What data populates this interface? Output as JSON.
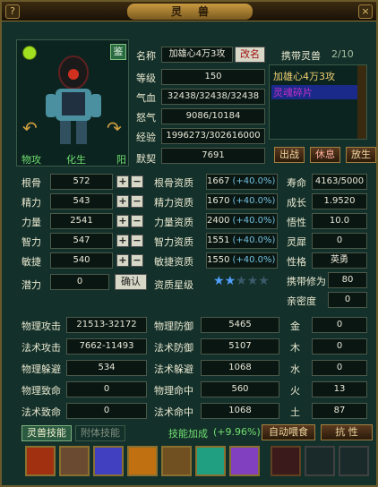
{
  "window": {
    "title": "灵兽",
    "help_icon": "?",
    "close_icon": "×"
  },
  "pet": {
    "left_tag": "物攻",
    "mid_tag": "化生",
    "right_tag": "阳",
    "appraise": "鉴",
    "name_label": "名称",
    "name": "加雄心4万3攻",
    "rename": "改名",
    "level_label": "等级",
    "level": "150",
    "hp_label": "气血",
    "hp": "32438/32438/32438",
    "rage_label": "怒气",
    "rage": "9086/10184",
    "exp_label": "经验",
    "exp": "1996273/302616000",
    "tacit_label": "默契",
    "tacit": "7691"
  },
  "carry": {
    "label": "携带灵兽",
    "count": "2/10",
    "items": [
      "加雄心4万3攻",
      "灵魂碎片"
    ],
    "fight": "出战",
    "rest": "休息",
    "release": "放生"
  },
  "attrs": [
    {
      "label": "根骨",
      "value": "572",
      "apt_label": "根骨资质",
      "apt": "1667",
      "pct": "(+40.0%)"
    },
    {
      "label": "精力",
      "value": "543",
      "apt_label": "精力资质",
      "apt": "1670",
      "pct": "(+40.0%)"
    },
    {
      "label": "力量",
      "value": "2541",
      "apt_label": "力量资质",
      "apt": "2400",
      "pct": "(+40.0%)"
    },
    {
      "label": "智力",
      "value": "547",
      "apt_label": "智力资质",
      "apt": "1551",
      "pct": "(+40.0%)"
    },
    {
      "label": "敏捷",
      "value": "540",
      "apt_label": "敏捷资质",
      "apt": "1550",
      "pct": "(+40.0%)"
    }
  ],
  "potential": {
    "label": "潜力",
    "value": "0",
    "confirm": "确认",
    "star_label": "资质星级"
  },
  "right_stats": [
    {
      "label": "寿命",
      "value": "4163/5000"
    },
    {
      "label": "成长",
      "value": "1.9520"
    },
    {
      "label": "悟性",
      "value": "10.0"
    },
    {
      "label": "灵犀",
      "value": "0"
    },
    {
      "label": "性格",
      "value": "英勇"
    },
    {
      "label": "携带修为",
      "value": "80"
    },
    {
      "label": "亲密度",
      "value": "0"
    }
  ],
  "combat": [
    {
      "l1": "物理攻击",
      "v1": "21513-32172",
      "l2": "物理防御",
      "v2": "5465",
      "l3": "金",
      "v3": "0"
    },
    {
      "l1": "法术攻击",
      "v1": "7662-11493",
      "l2": "法术防御",
      "v2": "5107",
      "l3": "木",
      "v3": "0"
    },
    {
      "l1": "物理躲避",
      "v1": "534",
      "l2": "法术躲避",
      "v2": "1068",
      "l3": "水",
      "v3": "0"
    },
    {
      "l1": "物理致命",
      "v1": "0",
      "l2": "物理命中",
      "v2": "560",
      "l3": "火",
      "v3": "13"
    },
    {
      "l1": "法术致命",
      "v1": "0",
      "l2": "法术命中",
      "v2": "1068",
      "l3": "土",
      "v3": "87"
    }
  ],
  "bottom": {
    "tab1": "灵兽技能",
    "tab2": "附体技能",
    "bonus_label": "技能加成",
    "bonus": "(+9.96%)",
    "auto_feed": "自动喂食",
    "resist": "抗 性"
  },
  "stars": {
    "filled": 2,
    "total": 5
  }
}
